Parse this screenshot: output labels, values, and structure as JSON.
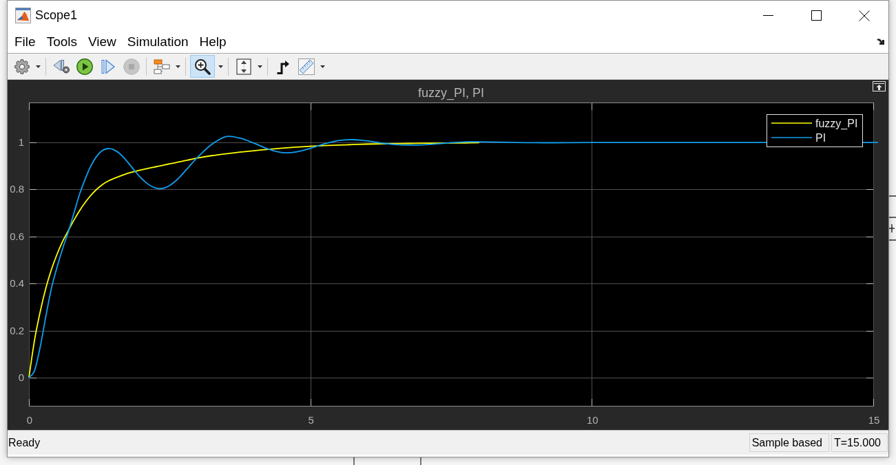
{
  "window": {
    "title": "Scope1"
  },
  "menu": [
    "File",
    "Tools",
    "View",
    "Simulation",
    "Help"
  ],
  "toolbar": [
    {
      "kind": "settings",
      "selected": false,
      "disabled": false,
      "dropdown": true
    },
    {
      "kind": "separator"
    },
    {
      "kind": "step_back",
      "selected": false,
      "disabled": false,
      "dropdown": false
    },
    {
      "kind": "run",
      "selected": false,
      "disabled": false,
      "dropdown": false
    },
    {
      "kind": "step_forward",
      "selected": false,
      "disabled": false,
      "dropdown": false
    },
    {
      "kind": "stop",
      "selected": false,
      "disabled": true,
      "dropdown": false
    },
    {
      "kind": "separator"
    },
    {
      "kind": "signal_hierarchy",
      "selected": false,
      "disabled": false,
      "dropdown": true
    },
    {
      "kind": "separator"
    },
    {
      "kind": "zoom",
      "selected": true,
      "disabled": false,
      "dropdown": true
    },
    {
      "kind": "separator"
    },
    {
      "kind": "autoscale",
      "selected": false,
      "disabled": false,
      "dropdown": true
    },
    {
      "kind": "separator"
    },
    {
      "kind": "triggers",
      "selected": false,
      "disabled": false,
      "dropdown": false
    },
    {
      "kind": "measurements",
      "selected": false,
      "disabled": false,
      "dropdown": true
    }
  ],
  "plot": {
    "chart_data": {
      "type": "line",
      "title": "fuzzy_PI, PI",
      "x": [
        0,
        0.1,
        0.2,
        0.3,
        0.4,
        0.5,
        0.6,
        0.7,
        0.8,
        0.9,
        1,
        1.1,
        1.2,
        1.3,
        1.4,
        1.5,
        1.6,
        1.7,
        1.8,
        1.9,
        2,
        2.1,
        2.2,
        2.3,
        2.4,
        2.5,
        2.6,
        2.7,
        2.8,
        2.9,
        3,
        3.25,
        3.5,
        3.75,
        4,
        4.25,
        4.5,
        4.75,
        5,
        5.25,
        5.5,
        5.75,
        6,
        6.25,
        6.5,
        6.75,
        7,
        7.25,
        7.5,
        7.75,
        8,
        9,
        10,
        11,
        12,
        13,
        14.9,
        15
      ],
      "series": [
        {
          "name": "fuzzy_PI",
          "color": "#ffff00",
          "values": [
            0,
            0.16,
            0.28,
            0.38,
            0.46,
            0.525,
            0.58,
            0.625,
            0.67,
            0.71,
            0.745,
            0.775,
            0.8,
            0.82,
            0.835,
            0.846,
            0.855,
            0.864,
            0.872,
            0.878,
            0.884,
            0.889,
            0.894,
            0.899,
            0.904,
            0.909,
            0.914,
            0.919,
            0.924,
            0.929,
            0.934,
            0.944,
            0.952,
            0.959,
            0.965,
            0.971,
            0.976,
            0.98,
            0.984,
            0.987,
            0.989,
            0.991,
            0.993,
            0.994,
            0.995,
            0.996,
            0.997,
            0.997,
            0.998,
            0.998,
            0.999,
            null,
            null,
            null,
            null,
            null,
            null,
            null
          ]
        },
        {
          "name": "PI",
          "color": "#0f9ff0",
          "values": [
            0,
            0.03,
            0.13,
            0.26,
            0.38,
            0.47,
            0.55,
            0.62,
            0.7,
            0.78,
            0.845,
            0.9,
            0.94,
            0.965,
            0.974,
            0.97,
            0.955,
            0.932,
            0.903,
            0.873,
            0.847,
            0.826,
            0.811,
            0.804,
            0.806,
            0.817,
            0.835,
            0.858,
            0.885,
            0.912,
            0.938,
            0.992,
            1.025,
            1.018,
            0.997,
            0.972,
            0.957,
            0.96,
            0.975,
            0.994,
            1.008,
            1.012,
            1.007,
            0.998,
            0.991,
            0.989,
            0.99,
            0.994,
            0.999,
            1.002,
            1.003,
            0.999,
            1,
            1,
            1,
            1,
            1,
            1
          ]
        }
      ],
      "xlim": [
        0,
        15
      ],
      "ylim": [
        -0.12,
        1.17
      ],
      "xticks": [
        0,
        5,
        10,
        15
      ],
      "yticks": [
        0,
        0.2,
        0.4,
        0.6,
        0.8,
        1
      ],
      "grid": true,
      "legend": "upper right"
    }
  },
  "status_bar": {
    "message": "Ready",
    "fields": [
      "Sample based",
      "T=15.000"
    ]
  }
}
